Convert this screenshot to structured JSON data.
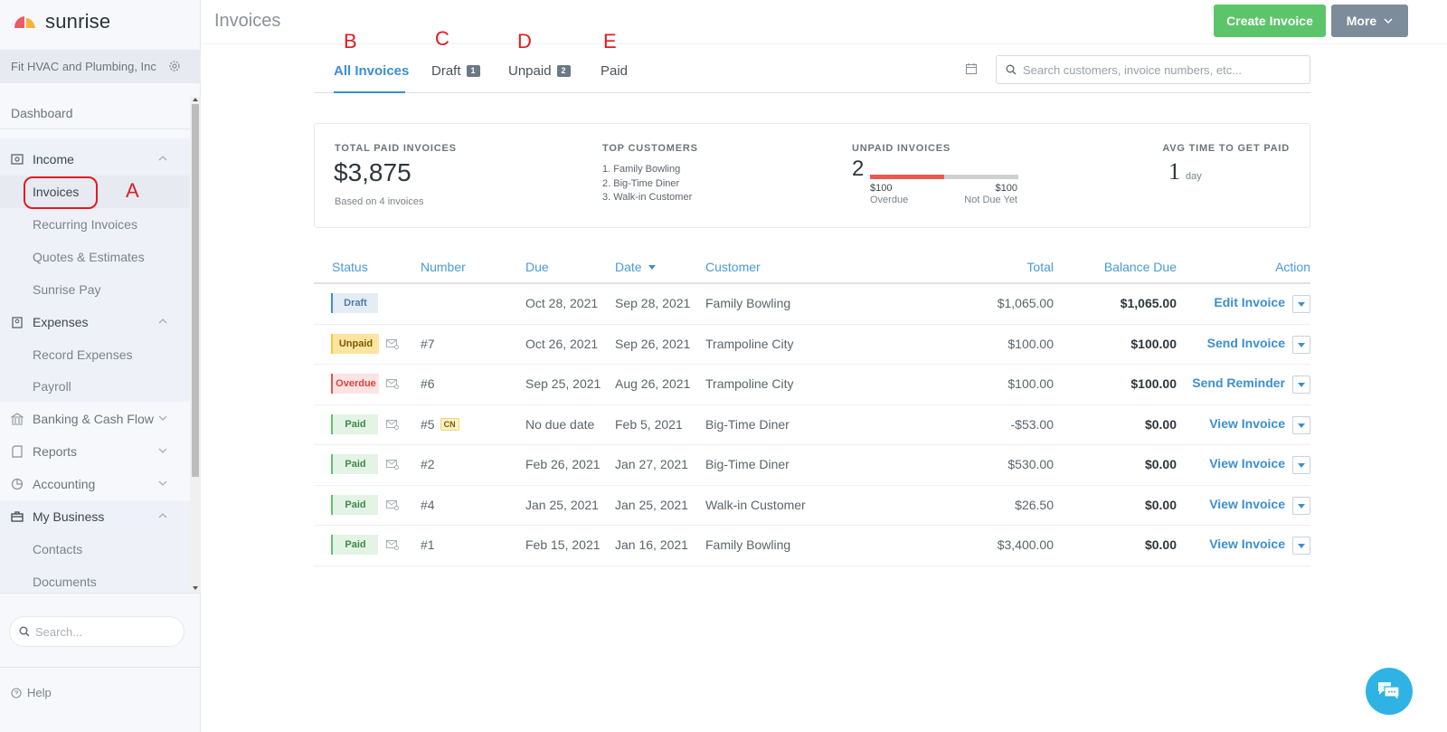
{
  "brand": {
    "name": "sunrise"
  },
  "company": {
    "name": "Fit HVAC and Plumbing, Inc"
  },
  "sidebar": {
    "dashboard": "Dashboard",
    "income": {
      "label": "Income",
      "items": [
        "Invoices",
        "Recurring Invoices",
        "Quotes & Estimates",
        "Sunrise Pay"
      ]
    },
    "expenses": {
      "label": "Expenses",
      "items": [
        "Record Expenses",
        "Payroll"
      ]
    },
    "banking": "Banking & Cash Flow",
    "reports": "Reports",
    "accounting": "Accounting",
    "my_business": {
      "label": "My Business",
      "items": [
        "Contacts",
        "Documents"
      ]
    },
    "active_item": "Invoices",
    "search_placeholder": "Search...",
    "help": "Help"
  },
  "annotations": {
    "a": "A",
    "b": "B",
    "c": "C",
    "d": "D",
    "e": "E"
  },
  "header": {
    "title": "Invoices",
    "create_label": "Create Invoice",
    "more_label": "More"
  },
  "tabs": [
    {
      "label": "All Invoices",
      "active": true
    },
    {
      "label": "Draft",
      "count": "1"
    },
    {
      "label": "Unpaid",
      "count": "2"
    },
    {
      "label": "Paid"
    }
  ],
  "search": {
    "placeholder": "Search customers, invoice numbers, etc..."
  },
  "summary": {
    "total_paid": {
      "label": "TOTAL PAID INVOICES",
      "value": "$3,875",
      "note": "Based on 4 invoices"
    },
    "top_customers": {
      "label": "TOP CUSTOMERS",
      "items": [
        "1.  Family Bowling",
        "2.  Big-Time Diner",
        "3.  Walk-in Customer"
      ]
    },
    "unpaid": {
      "label": "UNPAID INVOICES",
      "count": "2",
      "overdue_amount": "$100",
      "overdue_label": "Overdue",
      "not_due_amount": "$100",
      "not_due_label": "Not Due Yet",
      "overdue_fraction": 0.5
    },
    "avg_time": {
      "label": "AVG TIME TO GET PAID",
      "value": "1",
      "unit": "day"
    }
  },
  "table": {
    "columns": {
      "status": "Status",
      "number": "Number",
      "due": "Due",
      "date": "Date",
      "customer": "Customer",
      "total": "Total",
      "balance": "Balance Due",
      "action": "Action"
    },
    "rows": [
      {
        "status": "Draft",
        "number": "",
        "due": "Oct 28, 2021",
        "date": "Sep 28, 2021",
        "customer": "Family Bowling",
        "total": "$1,065.00",
        "balance": "$1,065.00",
        "action": "Edit Invoice"
      },
      {
        "status": "Unpaid",
        "number": "#7",
        "due": "Oct 26, 2021",
        "date": "Sep 26, 2021",
        "customer": "Trampoline City",
        "total": "$100.00",
        "balance": "$100.00",
        "action": "Send Invoice"
      },
      {
        "status": "Overdue",
        "number": "#6",
        "due": "Sep 25, 2021",
        "date": "Aug 26, 2021",
        "customer": "Trampoline City",
        "total": "$100.00",
        "balance": "$100.00",
        "action": "Send Reminder"
      },
      {
        "status": "Paid",
        "number": "#5",
        "tag": "CN",
        "due": "No due date",
        "date": "Feb 5, 2021",
        "customer": "Big-Time Diner",
        "total": "-$53.00",
        "balance": "$0.00",
        "action": "View Invoice"
      },
      {
        "status": "Paid",
        "number": "#2",
        "due": "Feb 26, 2021",
        "date": "Jan 27, 2021",
        "customer": "Big-Time Diner",
        "total": "$530.00",
        "balance": "$0.00",
        "action": "View Invoice"
      },
      {
        "status": "Paid",
        "number": "#4",
        "due": "Jan 25, 2021",
        "date": "Jan 25, 2021",
        "customer": "Walk-in Customer",
        "total": "$26.50",
        "balance": "$0.00",
        "action": "View Invoice"
      },
      {
        "status": "Paid",
        "number": "#1",
        "due": "Feb 15, 2021",
        "date": "Jan 16, 2021",
        "customer": "Family Bowling",
        "total": "$3,400.00",
        "balance": "$0.00",
        "action": "View Invoice"
      }
    ]
  },
  "colors": {
    "accent": "#3b8fd3",
    "create": "#5cc46a",
    "more": "#7d8c9b",
    "overdue": "#ea5a4f",
    "chat": "#2eb3e4"
  }
}
